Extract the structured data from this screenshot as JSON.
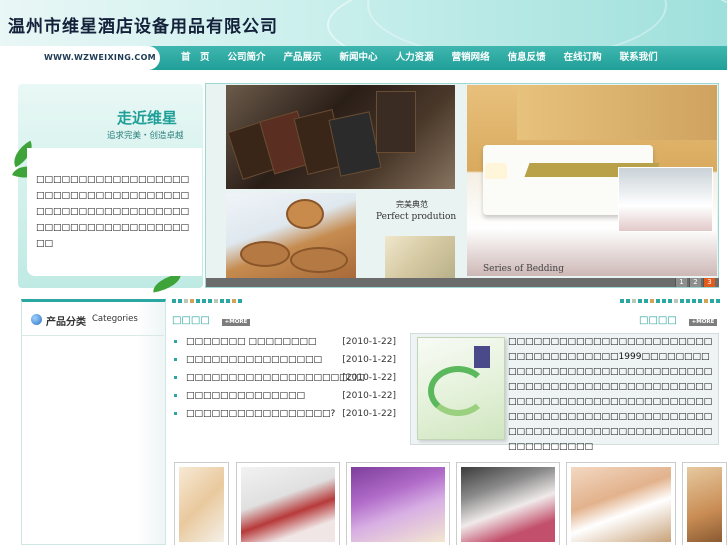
{
  "header": {
    "title": "温州市维星酒店设备用品有限公司",
    "url": "WWW.WZWEIXING.COM"
  },
  "nav": {
    "items": [
      "首　页",
      "公司简介",
      "产品展示",
      "新闻中心",
      "人力资源",
      "营销网络",
      "信息反馈",
      "在线订购",
      "联系我们"
    ]
  },
  "intro": {
    "title": "走近维星",
    "subtitle": "追求完美・创造卓越",
    "body": "□□□□□□□□□□□□□□□□□□□□□□□□□□□□□□□□□□□□□□□□□□□□□□□□□□□□□□□□□□□□□□□□□□□□□□□□□□"
  },
  "banner": {
    "perfect_cn": "完美典范",
    "perfect_en": "Perfect prodution",
    "bedding_en": "Series of Bedding",
    "pages": [
      "1",
      "2",
      "3"
    ],
    "active_page": "3"
  },
  "categories": {
    "title_cn": "产品分类",
    "title_en": "Categories"
  },
  "news": {
    "title": "□□□□",
    "more": "+MORE",
    "items": [
      {
        "text": "□□□□□□□ □□□□□□□□",
        "date": "[2010-1-22]"
      },
      {
        "text": "□□□□□□□□□□□□□□□□",
        "date": "[2010-1-22]"
      },
      {
        "text": "□□□□□□□□□□□□□□□□□□□□□",
        "date": "[2010-1-22]"
      },
      {
        "text": "□□□□□□□□□□□□□□",
        "date": "[2010-1-22]"
      },
      {
        "text": "□□□□□□□□□□□□□□□□□?",
        "date": "[2010-1-22]"
      }
    ]
  },
  "about": {
    "title": "□□□□",
    "more": "+MORE",
    "body": "□□□□□□□□□□□□□□□□□□□□□□□□□□□□□□□□□□□□□1999□□□□□□□□□□□□□□□□□□□□□□□□□□□□□□□□□□□□□□□□□□□□□□□□□□□□□□□□□□□□□□□□□□□□□□□□□□□□□□□□□□□□□□□□□□□□□□□□□□□□□□□□□□□□□□□□□□□□□□□□□□□□□□□□□□□□□□□□□□"
  },
  "colors": {
    "accent": "#1f9f98",
    "nav_bg": "#2aa7a0",
    "pager_active": "#e25b1d"
  }
}
